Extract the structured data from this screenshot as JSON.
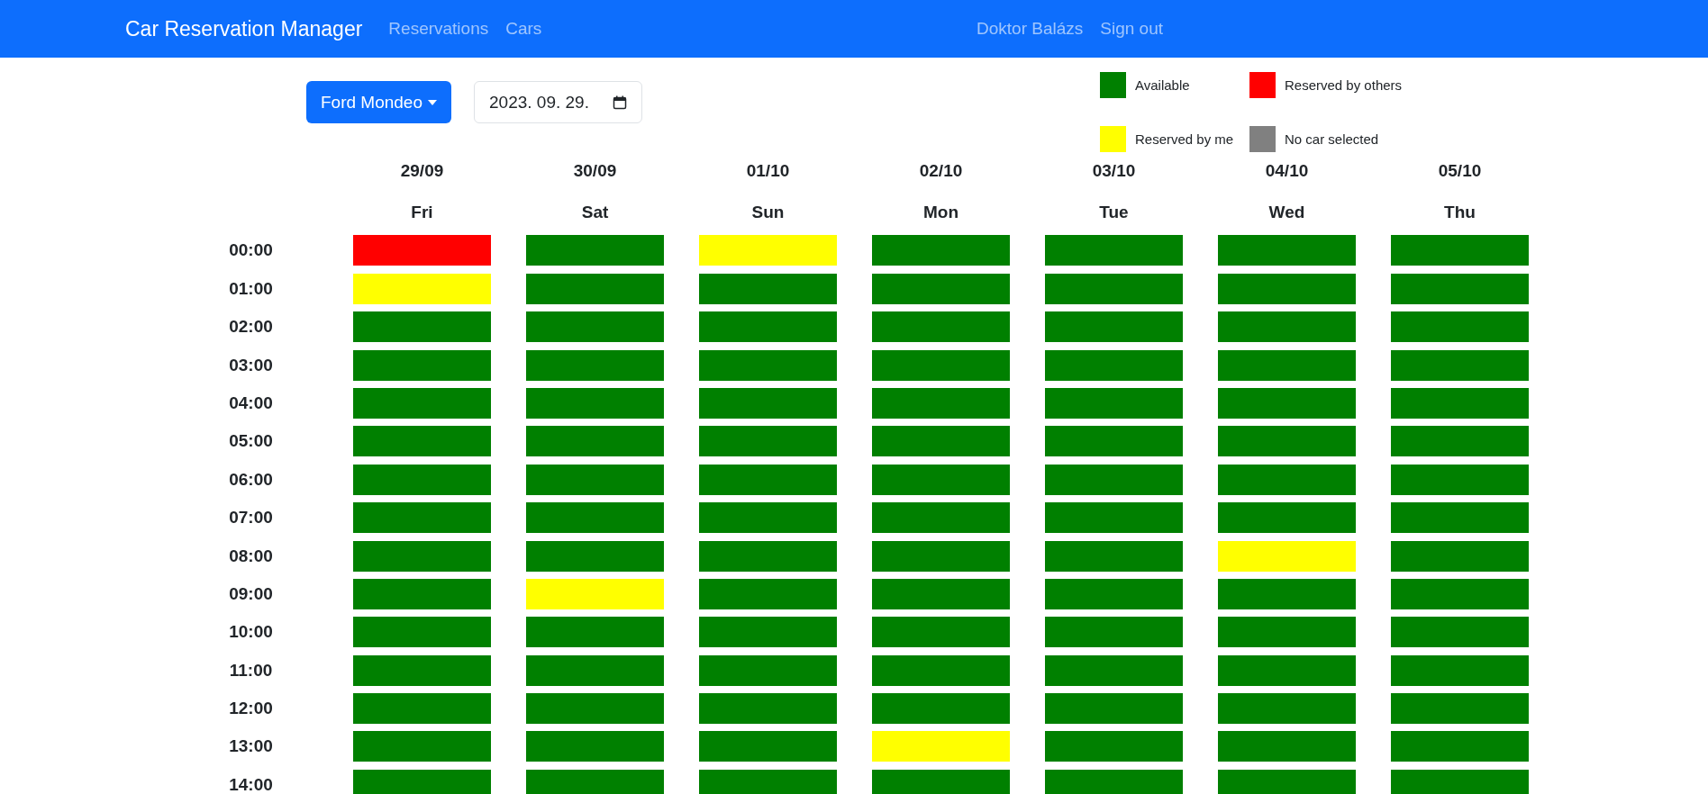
{
  "navbar": {
    "brand": "Car Reservation Manager",
    "links": [
      "Reservations",
      "Cars"
    ],
    "user_links": [
      "Doktor Balázs",
      "Sign out"
    ]
  },
  "controls": {
    "car_dropdown": "Ford Mondeo",
    "date_field": "2023. 09. 29."
  },
  "legend": [
    {
      "label": "Available",
      "color": "#008000"
    },
    {
      "label": "Reserved by others",
      "color": "#ff0000"
    },
    {
      "label": "Reserved by me",
      "color": "#ffff00"
    },
    {
      "label": "No car selected",
      "color": "#808080"
    }
  ],
  "days": [
    {
      "date": "29/09",
      "weekday": "Fri"
    },
    {
      "date": "30/09",
      "weekday": "Sat"
    },
    {
      "date": "01/10",
      "weekday": "Sun"
    },
    {
      "date": "02/10",
      "weekday": "Mon"
    },
    {
      "date": "03/10",
      "weekday": "Tue"
    },
    {
      "date": "04/10",
      "weekday": "Wed"
    },
    {
      "date": "05/10",
      "weekday": "Thu"
    }
  ],
  "rows": [
    {
      "time": "00:00",
      "cells": [
        {
          "color": "#ff0000"
        },
        {
          "color": "#008000"
        },
        {
          "color": "#ffff00"
        },
        {
          "color": "#008000"
        },
        {
          "color": "#008000"
        },
        {
          "color": "#008000"
        },
        {
          "color": "#008000"
        }
      ]
    },
    {
      "time": "01:00",
      "cells": [
        {
          "color": "#ffff00"
        },
        {
          "color": "#008000"
        },
        {
          "color": "#008000"
        },
        {
          "color": "#008000"
        },
        {
          "color": "#008000"
        },
        {
          "color": "#008000"
        },
        {
          "color": "#008000"
        }
      ]
    },
    {
      "time": "02:00",
      "cells": [
        {
          "color": "#008000"
        },
        {
          "color": "#008000"
        },
        {
          "color": "#008000"
        },
        {
          "color": "#008000"
        },
        {
          "color": "#008000"
        },
        {
          "color": "#008000"
        },
        {
          "color": "#008000"
        }
      ]
    },
    {
      "time": "03:00",
      "cells": [
        {
          "color": "#008000"
        },
        {
          "color": "#008000"
        },
        {
          "color": "#008000"
        },
        {
          "color": "#008000"
        },
        {
          "color": "#008000"
        },
        {
          "color": "#008000"
        },
        {
          "color": "#008000"
        }
      ]
    },
    {
      "time": "04:00",
      "cells": [
        {
          "color": "#008000"
        },
        {
          "color": "#008000"
        },
        {
          "color": "#008000"
        },
        {
          "color": "#008000"
        },
        {
          "color": "#008000"
        },
        {
          "color": "#008000"
        },
        {
          "color": "#008000"
        }
      ]
    },
    {
      "time": "05:00",
      "cells": [
        {
          "color": "#008000"
        },
        {
          "color": "#008000"
        },
        {
          "color": "#008000"
        },
        {
          "color": "#008000"
        },
        {
          "color": "#008000"
        },
        {
          "color": "#008000"
        },
        {
          "color": "#008000"
        }
      ]
    },
    {
      "time": "06:00",
      "cells": [
        {
          "color": "#008000"
        },
        {
          "color": "#008000"
        },
        {
          "color": "#008000"
        },
        {
          "color": "#008000"
        },
        {
          "color": "#008000"
        },
        {
          "color": "#008000"
        },
        {
          "color": "#008000"
        }
      ]
    },
    {
      "time": "07:00",
      "cells": [
        {
          "color": "#008000"
        },
        {
          "color": "#008000"
        },
        {
          "color": "#008000"
        },
        {
          "color": "#008000"
        },
        {
          "color": "#008000"
        },
        {
          "color": "#008000"
        },
        {
          "color": "#008000"
        }
      ]
    },
    {
      "time": "08:00",
      "cells": [
        {
          "color": "#008000"
        },
        {
          "color": "#008000"
        },
        {
          "color": "#008000"
        },
        {
          "color": "#008000"
        },
        {
          "color": "#008000"
        },
        {
          "color": "#ffff00"
        },
        {
          "color": "#008000"
        }
      ]
    },
    {
      "time": "09:00",
      "cells": [
        {
          "color": "#008000"
        },
        {
          "color": "#ffff00"
        },
        {
          "color": "#008000"
        },
        {
          "color": "#008000"
        },
        {
          "color": "#008000"
        },
        {
          "color": "#008000"
        },
        {
          "color": "#008000"
        }
      ]
    },
    {
      "time": "10:00",
      "cells": [
        {
          "color": "#008000"
        },
        {
          "color": "#008000"
        },
        {
          "color": "#008000"
        },
        {
          "color": "#008000"
        },
        {
          "color": "#008000"
        },
        {
          "color": "#008000"
        },
        {
          "color": "#008000"
        }
      ]
    },
    {
      "time": "11:00",
      "cells": [
        {
          "color": "#008000"
        },
        {
          "color": "#008000"
        },
        {
          "color": "#008000"
        },
        {
          "color": "#008000"
        },
        {
          "color": "#008000"
        },
        {
          "color": "#008000"
        },
        {
          "color": "#008000"
        }
      ]
    },
    {
      "time": "12:00",
      "cells": [
        {
          "color": "#008000"
        },
        {
          "color": "#008000"
        },
        {
          "color": "#008000"
        },
        {
          "color": "#008000"
        },
        {
          "color": "#008000"
        },
        {
          "color": "#008000"
        },
        {
          "color": "#008000"
        }
      ]
    },
    {
      "time": "13:00",
      "cells": [
        {
          "color": "#008000"
        },
        {
          "color": "#008000"
        },
        {
          "color": "#008000"
        },
        {
          "color": "#ffff00"
        },
        {
          "color": "#008000"
        },
        {
          "color": "#008000"
        },
        {
          "color": "#008000"
        }
      ]
    },
    {
      "time": "14:00",
      "cells": [
        {
          "color": "#008000"
        },
        {
          "color": "#008000"
        },
        {
          "color": "#008000"
        },
        {
          "color": "#008000"
        },
        {
          "color": "#008000"
        },
        {
          "color": "#008000"
        },
        {
          "color": "#008000"
        }
      ]
    }
  ]
}
